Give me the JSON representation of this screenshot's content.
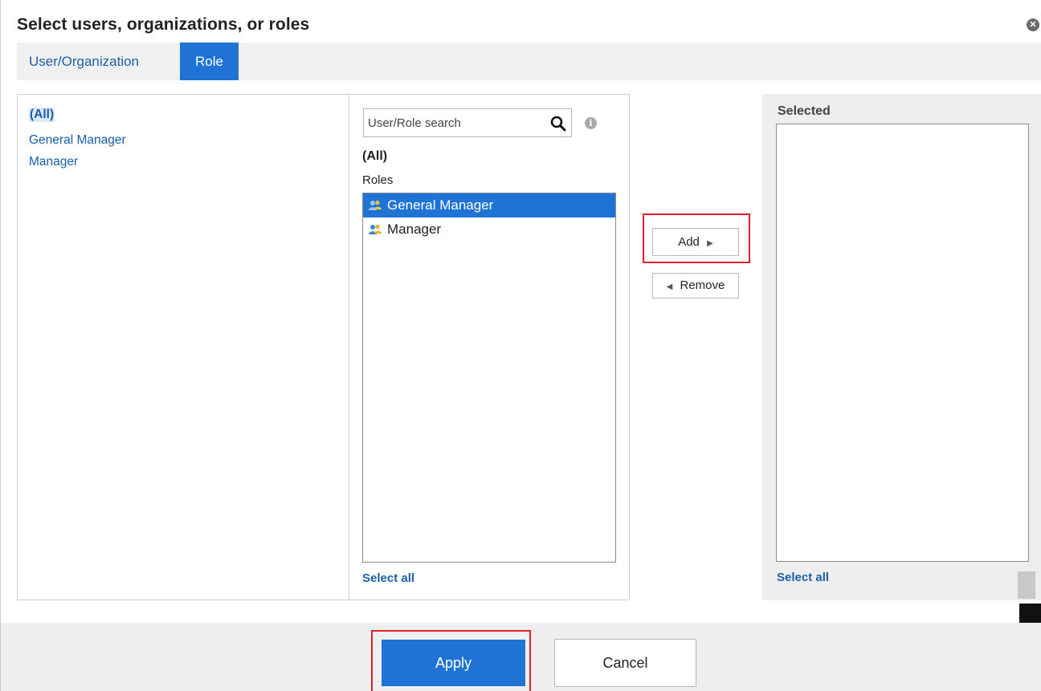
{
  "dialog": {
    "title": "Select users, organizations, or roles",
    "close_icon": "close-icon"
  },
  "tabs": [
    {
      "label": "User/Organization",
      "active": false
    },
    {
      "label": "Role",
      "active": true
    }
  ],
  "left_panel": {
    "items": [
      {
        "label": "(All)",
        "selected": true
      },
      {
        "label": "General Manager",
        "selected": false
      },
      {
        "label": "Manager",
        "selected": false
      }
    ]
  },
  "middle_panel": {
    "search": {
      "placeholder": "User/Role search",
      "value": "",
      "icon": "search-icon"
    },
    "info_icon": "info-icon",
    "group_heading": "(All)",
    "list_heading": "Roles",
    "roles": [
      {
        "label": "General Manager",
        "selected": true,
        "icon": "role-icon"
      },
      {
        "label": "Manager",
        "selected": false,
        "icon": "role-icon"
      }
    ],
    "select_all": "Select all"
  },
  "actions": {
    "add_label": "Add",
    "add_icon": "triangle-right-icon",
    "remove_label": "Remove",
    "remove_icon": "triangle-left-icon"
  },
  "right_panel": {
    "heading": "Selected",
    "items": [],
    "select_all": "Select all"
  },
  "footer": {
    "apply_label": "Apply",
    "cancel_label": "Cancel"
  },
  "colors": {
    "accent": "#1f73d4",
    "link": "#1a5fa8",
    "highlight_border": "#e0202b"
  }
}
